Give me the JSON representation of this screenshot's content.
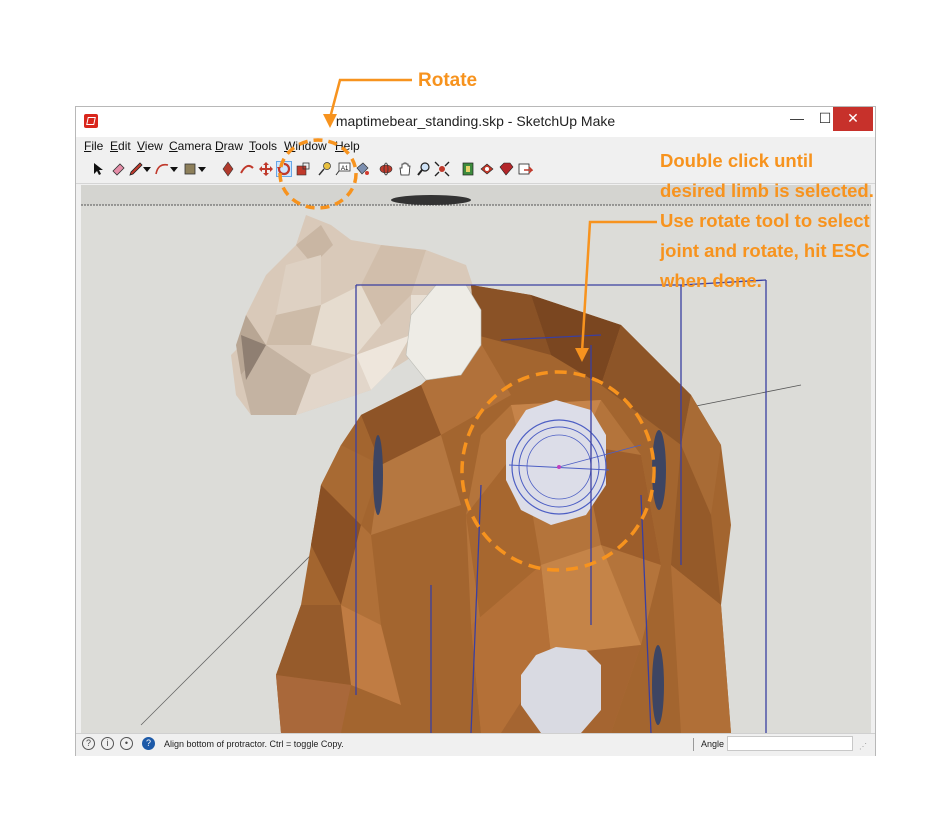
{
  "window": {
    "title": "maptimebear_standing.skp - SketchUp Make",
    "controls": {
      "minimize": "—",
      "maximize": "☐",
      "close": "✕"
    }
  },
  "menu": [
    {
      "id": "file",
      "label": "File"
    },
    {
      "id": "edit",
      "label": "Edit"
    },
    {
      "id": "view",
      "label": "View"
    },
    {
      "id": "camera",
      "label": "Camera"
    },
    {
      "id": "draw",
      "label": "Draw"
    },
    {
      "id": "tools",
      "label": "Tools"
    },
    {
      "id": "window",
      "label": "Window"
    },
    {
      "id": "help",
      "label": "Help"
    }
  ],
  "toolbar": {
    "tools": [
      "select-tool",
      "eraser-tool",
      "pencil-tool",
      "arc-tool",
      "shapes-tool",
      "push-pull-tool",
      "follow-me-tool",
      "move-tool",
      "rotate-tool",
      "scale-tool",
      "tape-measure-tool",
      "text-tool",
      "paint-bucket-tool",
      "orbit-tool",
      "pan-tool",
      "zoom-tool",
      "zoom-extents-tool",
      "3d-warehouse-tool",
      "extension-warehouse-tool",
      "ruby-tool",
      "layout-tool"
    ],
    "active_tool": "rotate-tool"
  },
  "status": {
    "hint": "Align bottom of protractor.  Ctrl = toggle Copy.",
    "angle_label": "Angle",
    "angle_value": ""
  },
  "annotations": {
    "rotate": "Rotate",
    "instructions": [
      "Double click until",
      "desired limb is selected.",
      "Use rotate tool to select",
      "joint and rotate, hit ESC",
      "when done."
    ],
    "accent_color": "#f7931e"
  },
  "colors": {
    "model_brown": "#a0622d",
    "model_beige": "#d8cabc",
    "selection_blue": "#3a3fa0",
    "protractor": "#4d5fc4",
    "background": "#dadad6"
  }
}
